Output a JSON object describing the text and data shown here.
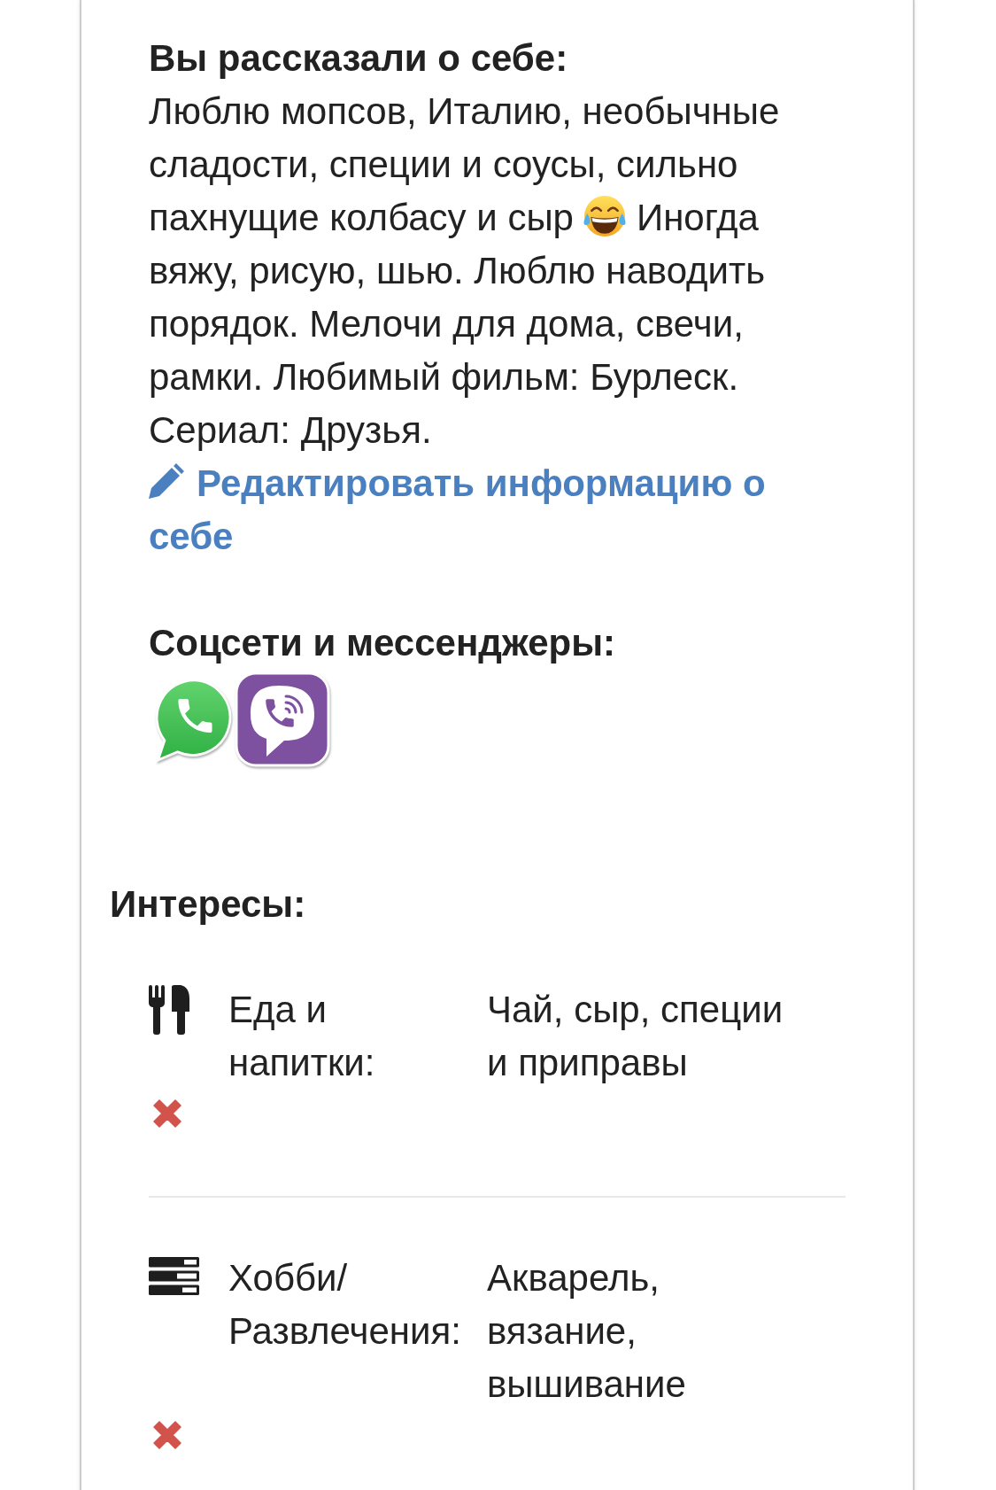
{
  "about": {
    "title": "Вы рассказали о себе:",
    "segments": [
      {
        "kind": "text",
        "text": "Люблю мопсов, Италию, необычные сладости, специи и соусы, сильно пахнущие колбасу и сыр"
      },
      {
        "kind": "emoji"
      },
      {
        "kind": "text",
        "text": "Иногда вяжу, рисую, шью. Люблю наводить порядок. Мелочи для дома, свечи, рамки. Любимый фильм: Бурлеск. Сериал: Друзья."
      }
    ],
    "edit_link": "Редактировать информацию о себе"
  },
  "socials": {
    "title": "Соцсети и мессенджеры:",
    "items": [
      {
        "kind": "whatsapp"
      },
      {
        "kind": "viber"
      }
    ]
  },
  "interests": {
    "title": "Интересы:",
    "items": [
      {
        "kind": "food",
        "label": "Еда и напитки:",
        "value": "Чай, сыр, специи и приправы"
      },
      {
        "kind": "hobby",
        "label": "Хобби/Развлечения:",
        "value": "Акварель, вязание, вышивание"
      }
    ]
  }
}
